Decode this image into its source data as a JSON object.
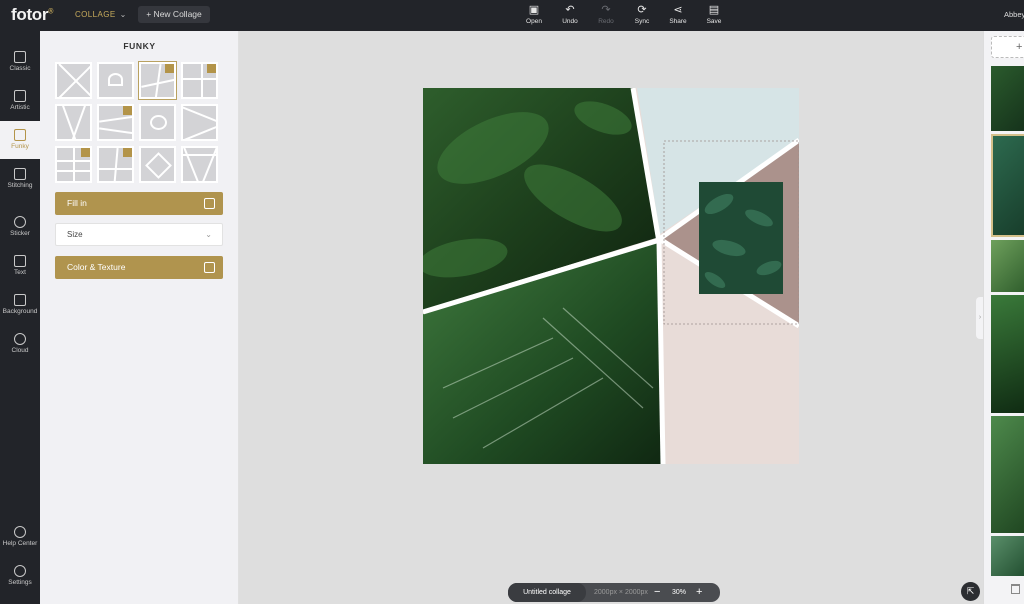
{
  "header": {
    "logo": "fotor",
    "logo_mark": "®",
    "mode_label": "COLLAGE",
    "new_collage_label": "+ New Collage",
    "tools": [
      {
        "label": "Open",
        "icon": "open-icon"
      },
      {
        "label": "Undo",
        "icon": "undo-icon"
      },
      {
        "label": "Redo",
        "icon": "redo-icon"
      },
      {
        "label": "Sync",
        "icon": "sync-icon"
      },
      {
        "label": "Share",
        "icon": "share-icon"
      },
      {
        "label": "Save",
        "icon": "save-icon"
      }
    ],
    "user_name": "Abbey"
  },
  "sidebar": {
    "items": [
      {
        "label": "Classic",
        "icon": "classic-icon"
      },
      {
        "label": "Artistic",
        "icon": "artistic-icon"
      },
      {
        "label": "Funky",
        "icon": "funky-icon",
        "active": true
      },
      {
        "label": "Stitching",
        "icon": "stitching-icon"
      },
      {
        "label": "Sticker",
        "icon": "sticker-icon"
      },
      {
        "label": "Text",
        "icon": "text-icon"
      },
      {
        "label": "Background",
        "icon": "background-icon"
      },
      {
        "label": "Cloud",
        "icon": "cloud-icon"
      }
    ],
    "bottom_items": [
      {
        "label": "Help Center",
        "icon": "help-icon"
      },
      {
        "label": "Settings",
        "icon": "settings-icon"
      }
    ]
  },
  "panel": {
    "title": "FUNKY",
    "fill_in_label": "Fill in",
    "size_label": "Size",
    "color_texture_label": "Color & Texture"
  },
  "canvas": {
    "doc_name": "Untitled collage",
    "doc_size": "2000px × 2000px",
    "zoom": "30%",
    "minus": "−",
    "plus": "+"
  },
  "rightpanel": {
    "add_label": "+"
  },
  "colors": {
    "topbar_bg": "#222429",
    "accent_gold": "#b0944e",
    "canvas_blue": "#d6e4e6",
    "canvas_mauve": "#ab928c",
    "canvas_blush": "#e8dcd8"
  }
}
